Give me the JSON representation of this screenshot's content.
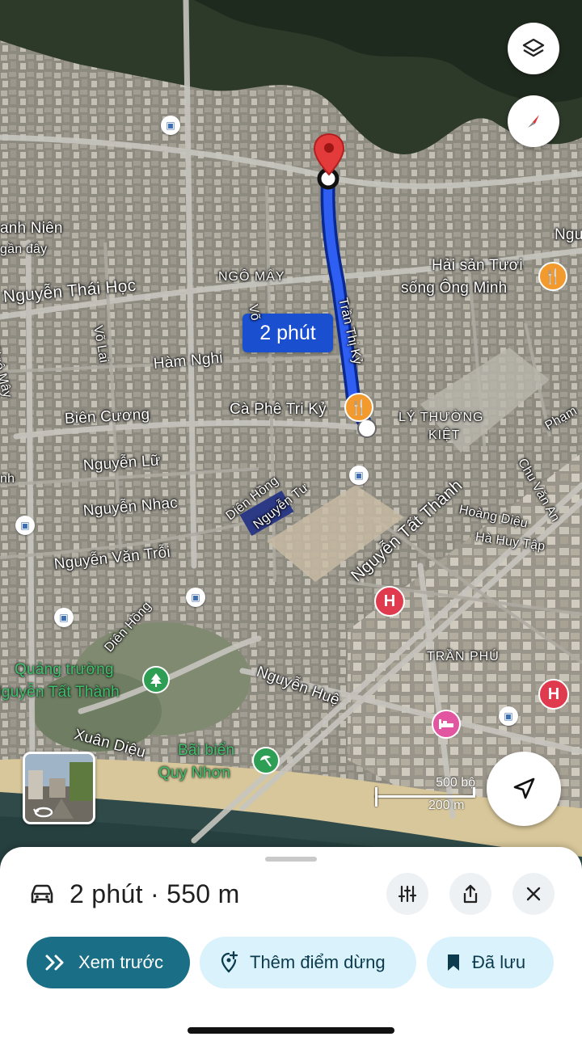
{
  "map": {
    "eta_callout": "2 phút",
    "streets": {
      "nguyen_thai_hoc": "Nguyễn Thái Học",
      "ngo_may_top": "NGÔ MÂY",
      "ngo_may_side": "Ngô Mây",
      "vo_lai": "Võ Lai",
      "ham_nghi": "Hàm Nghi",
      "bien_cuong": "Biên Cương",
      "nguyen_lu": "Nguyễn Lữ",
      "nguyen_nhac": "Nguyễn Nhạc",
      "nguyen_van_troi": "Nguyễn Văn Trỗi",
      "dien_hong_a": "Diên Hồng",
      "dien_hong_b": "Diên Hồng",
      "nguyen_tu": "Nguyễn Tư",
      "tran_thi_ky": "Trần Thị Kỷ",
      "vo": "Võ",
      "ly_thuong_kiet_1": "LÝ THƯỜNG",
      "ly_thuong_kiet_2": "KIỆT",
      "nguyen_tat_thanh": "Nguyễn Tất Thành",
      "hoang_dieu": "Hoàng Diệu",
      "ha_huy_tap": "Hà Huy Tập",
      "chu_van_an": "Chu Văn An",
      "pham": "Phạm",
      "tran_phu": "TRẦN PHÚ",
      "nguyen_hue": "Nguyễn Huệ",
      "xuan_dieu": "Xuân Diệu",
      "ngu": "Ngu",
      "anh_nien": "anh Niên",
      "gan_day": "gần đây",
      "nh": "nh"
    },
    "places": {
      "hai_san_1": "Hải sản Tươi",
      "hai_san_2": "sống Ông Minh",
      "ca_phe": "Cà Phê Tri Kỷ",
      "quang_truong_1": "Quảng trường",
      "quang_truong_2": "Nguyễn Tất Thành",
      "bai_bien_1": "Bãi biển",
      "bai_bien_2": "Quy Nhơn"
    },
    "scale": {
      "imperial": "500 bộ",
      "metric": "200 m"
    },
    "icons": {
      "layers": "layers-icon",
      "compass": "compass-icon",
      "locate": "navigation-arrow-icon",
      "destination": "red-pin-icon",
      "restaurant": "fork-knife-icon",
      "hospital": "hospital-h-icon",
      "hotel": "bed-icon",
      "park": "tree-icon",
      "beach": "umbrella-icon",
      "bus": "bus-icon"
    },
    "colors": {
      "route": "#1a4fd0",
      "restaurant": "#f29a2e",
      "hospital": "#e03a4f",
      "hotel": "#e255a0",
      "park": "#2f9e55"
    }
  },
  "sheet": {
    "summary": "2 phút · 550 m",
    "buttons": {
      "preview": "Xem trước",
      "add_stop": "Thêm điểm dừng",
      "saved": "Đã lưu"
    }
  }
}
